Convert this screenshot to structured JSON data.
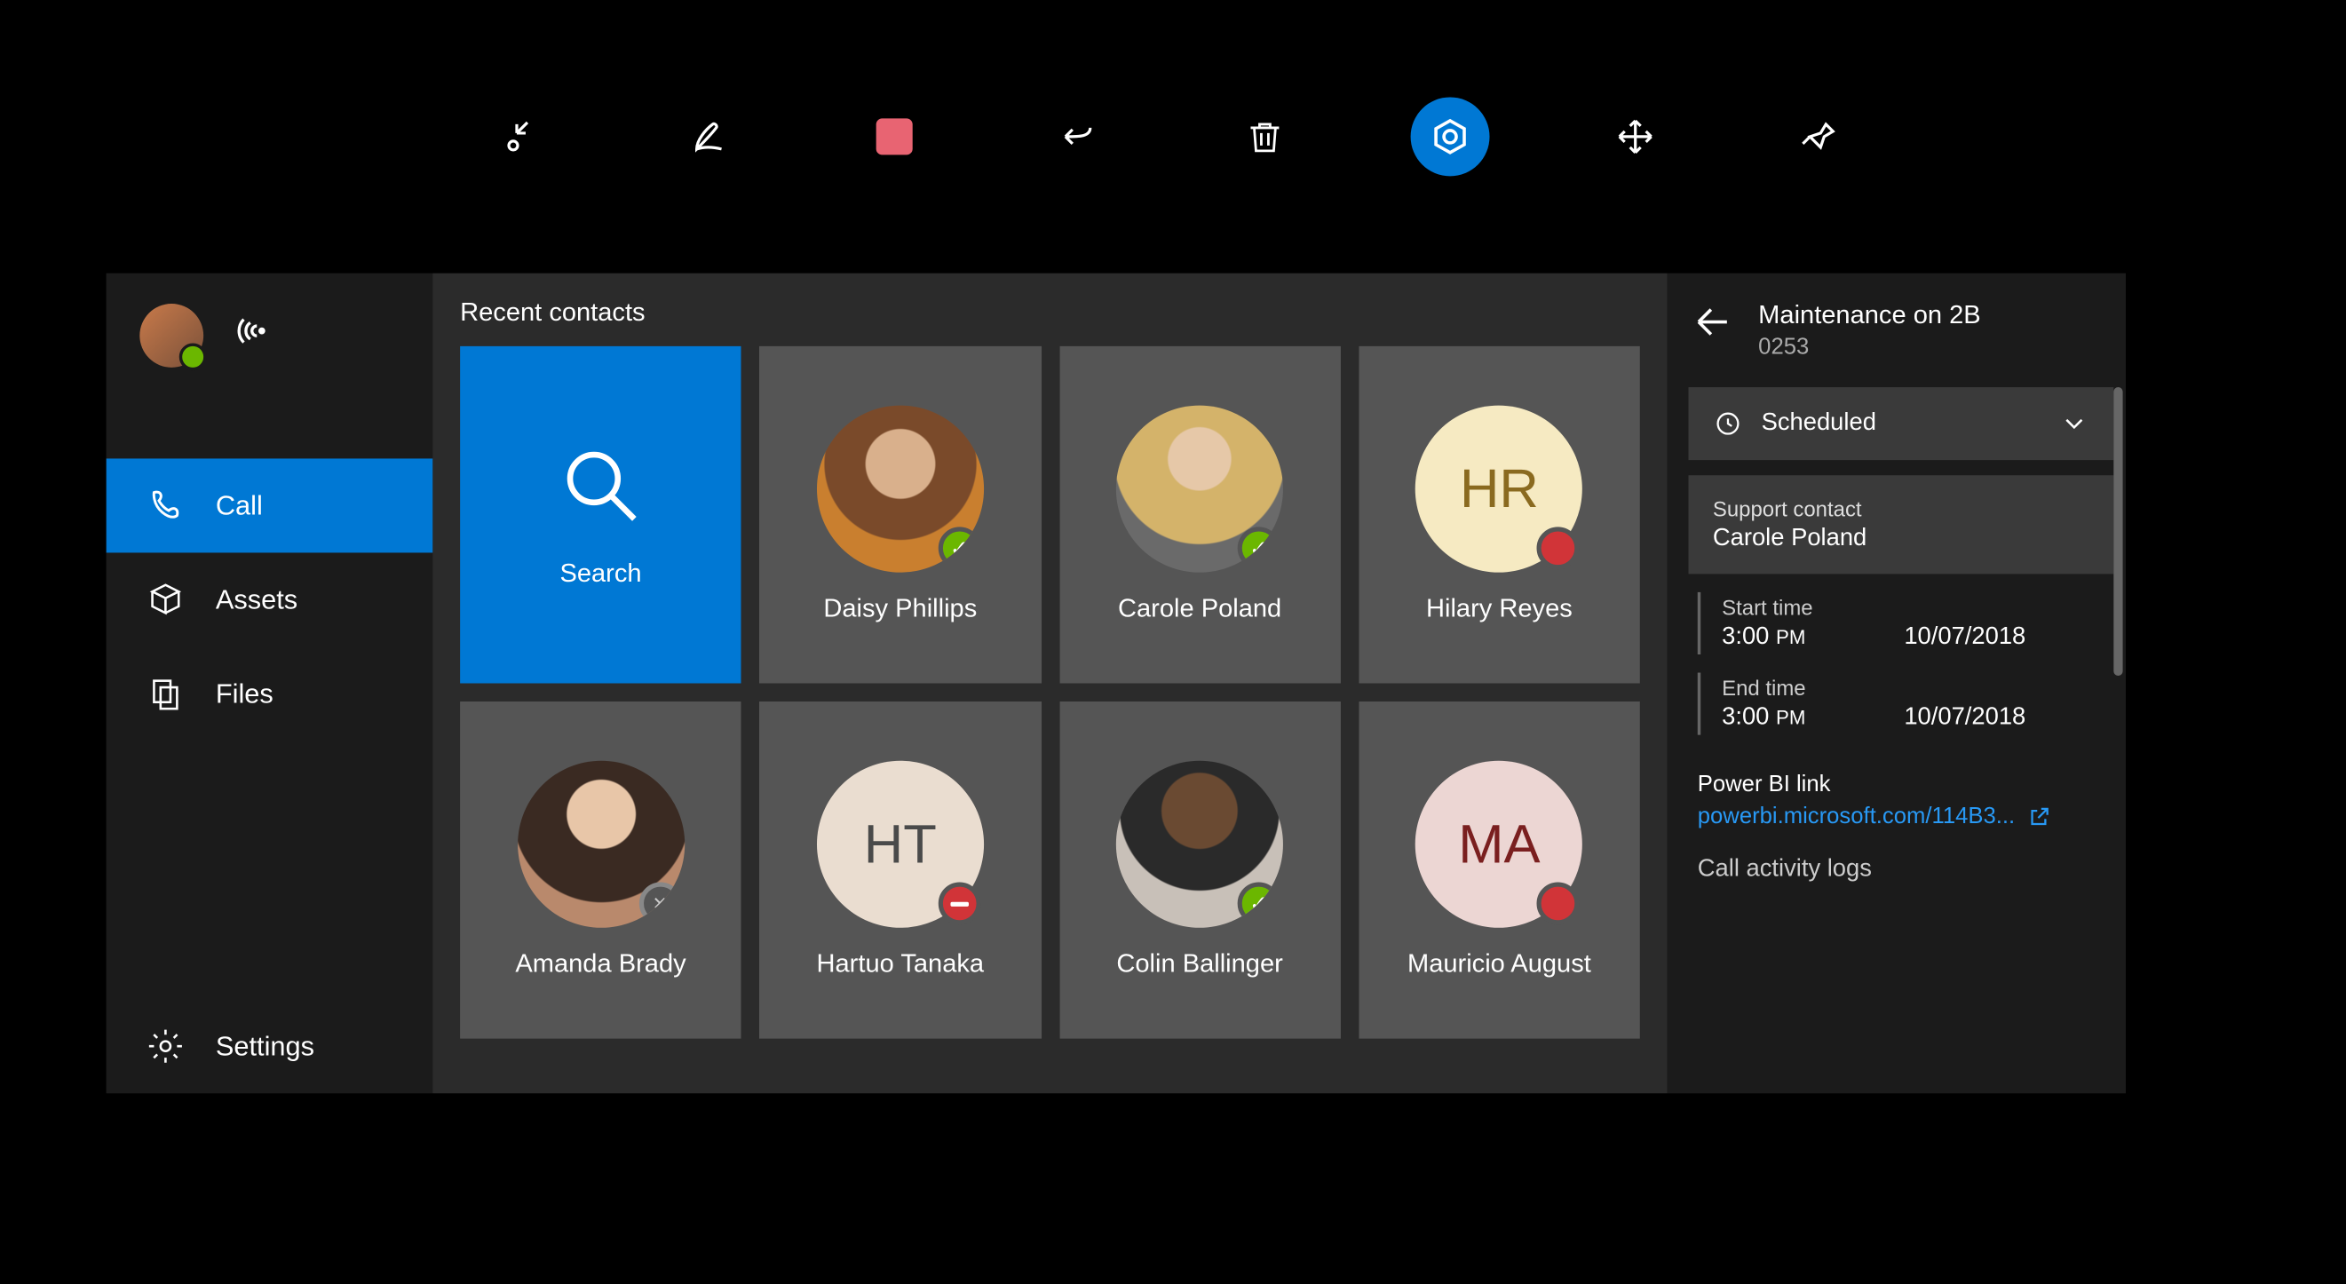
{
  "toolbar": {
    "icons": [
      "arrow-in",
      "ink-pen",
      "square",
      "undo",
      "trash",
      "assist",
      "move",
      "pin"
    ]
  },
  "sidebar": {
    "items": [
      {
        "icon": "phone",
        "label": "Call",
        "active": true
      },
      {
        "icon": "cube",
        "label": "Assets",
        "active": false
      },
      {
        "icon": "documents",
        "label": "Files",
        "active": false
      }
    ],
    "settings_label": "Settings"
  },
  "contacts": {
    "heading": "Recent contacts",
    "search_label": "Search",
    "cards": [
      {
        "type": "search"
      },
      {
        "name": "Daisy Phillips",
        "avatar": "photo",
        "bg": "#b0876a",
        "presence": "green"
      },
      {
        "name": "Carole Poland",
        "avatar": "photo",
        "bg": "#a89070",
        "presence": "green"
      },
      {
        "name": "Hilary Reyes",
        "avatar": "initials",
        "initials": "HR",
        "bg": "#f6eac2",
        "presence": "red-dot"
      },
      {
        "name": "Amanda Brady",
        "avatar": "photo",
        "bg": "#8a6a5a",
        "presence": "offline"
      },
      {
        "name": "Hartuo Tanaka",
        "avatar": "initials",
        "initials": "HT",
        "bg": "#eaddd0",
        "presence": "busy"
      },
      {
        "name": "Colin Ballinger",
        "avatar": "photo",
        "bg": "#5a4a3a",
        "presence": "green"
      },
      {
        "name": "Mauricio August",
        "avatar": "initials",
        "initials": "MA",
        "bg": "#ecd6d3",
        "presence": "red-dot"
      }
    ]
  },
  "detail": {
    "title": "Maintenance on 2B",
    "subtitle": "0253",
    "status_label": "Scheduled",
    "support_label": "Support contact",
    "support_value": "Carole Poland",
    "start_label": "Start time",
    "start_time": "3:00",
    "start_ampm": "PM",
    "start_date": "10/07/2018",
    "end_label": "End time",
    "end_time": "3:00",
    "end_ampm": "PM",
    "end_date": "10/07/2018",
    "powerbi_label": "Power BI link",
    "powerbi_link": "powerbi.microsoft.com/114B3...",
    "activity_label": "Call activity logs"
  }
}
